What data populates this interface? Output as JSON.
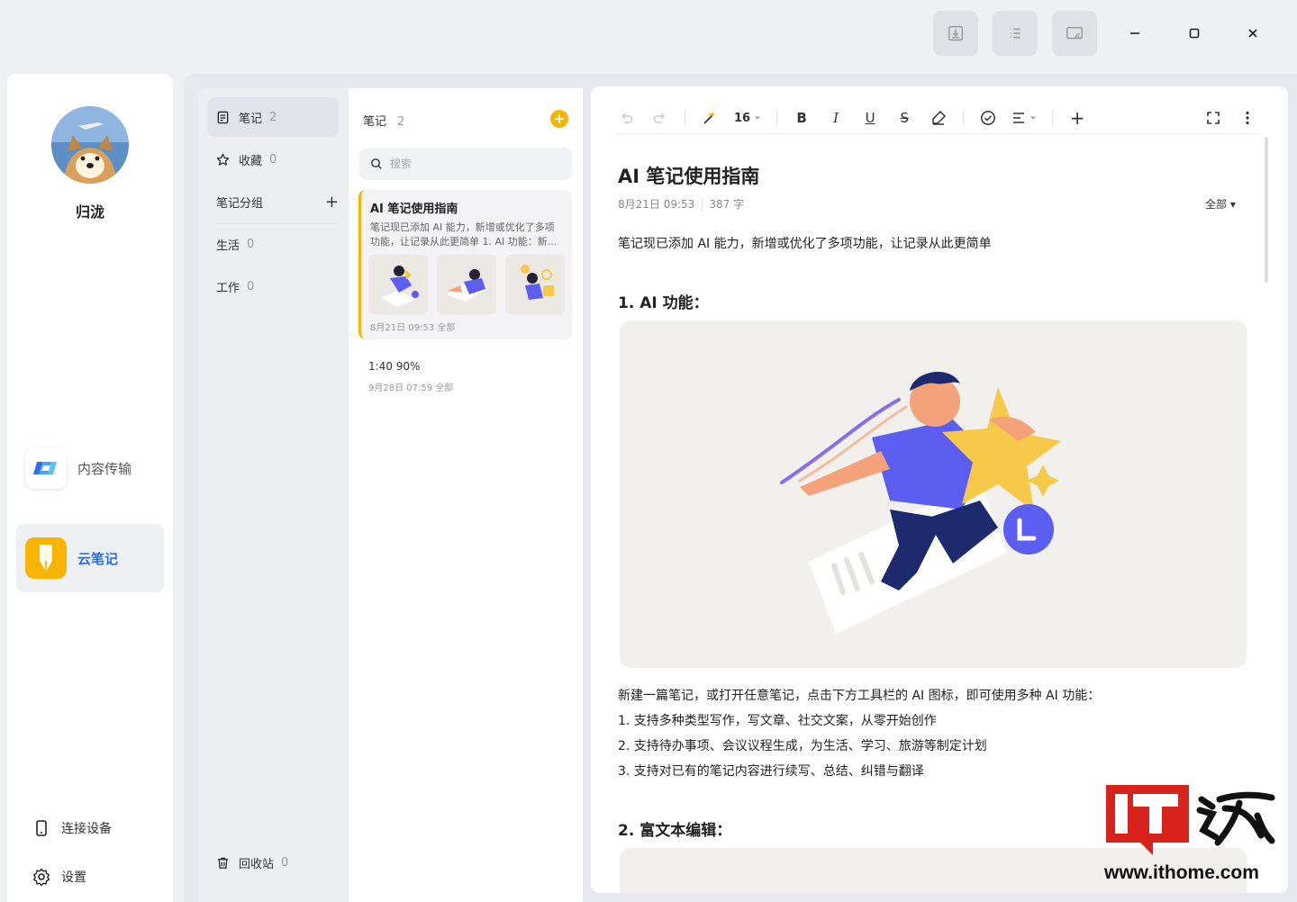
{
  "titlebar": {
    "buttons": [
      {
        "icon": "import-icon"
      },
      {
        "icon": "list-icon"
      },
      {
        "icon": "cast-icon"
      }
    ],
    "window_controls": [
      "minimize-icon",
      "maximize-icon",
      "close-icon"
    ]
  },
  "sidebar": {
    "username": "归泷",
    "apps": [
      {
        "label": "内容传输",
        "icon": "transfer-icon",
        "active": false
      },
      {
        "label": "云笔记",
        "icon": "cloud-notes-icon",
        "active": true
      }
    ],
    "bottom": [
      {
        "label": "连接设备",
        "icon": "phone-icon"
      },
      {
        "label": "设置",
        "icon": "gear-icon"
      }
    ]
  },
  "categories": {
    "notes": {
      "label": "笔记",
      "count": "2"
    },
    "favorites": {
      "label": "收藏",
      "count": "0"
    },
    "group_header": "笔记分组",
    "groups": [
      {
        "label": "生活",
        "count": "0"
      },
      {
        "label": "工作",
        "count": "0"
      }
    ],
    "trash": {
      "label": "回收站",
      "count": "0"
    }
  },
  "notes_list": {
    "title": "笔记",
    "count": "2",
    "search_placeholder": "搜索",
    "items": [
      {
        "title": "AI 笔记使用指南",
        "snippet": "笔记现已添加 AI 能力，新增或优化了多项功能，让记录从此更简单 1. AI 功能：新...",
        "meta": "8月21日 09:53  全部"
      },
      {
        "title": "1:40 90%",
        "meta": "9月28日 07:59  全部"
      }
    ]
  },
  "editor": {
    "toolbar": {
      "font_size": "16",
      "bold": "B",
      "italic": "I",
      "underline": "U",
      "strike": "S",
      "add": "+"
    },
    "title": "AI 笔记使用指南",
    "date": "8月21日 09:53",
    "word_count": "387 字",
    "filter": "全部 ▾",
    "intro": "笔记现已添加 AI 能力，新增或优化了多项功能，让记录从此更简单",
    "section1": "1. AI 功能：",
    "paragraph1": "新建一篇笔记，或打开任意笔记，点击下方工具栏的 AI 图标，即可使用多种 AI 功能：",
    "list": [
      "1. 支持多种类型写作，写文章、社交文案，从零开始创作",
      "2. 支持待办事项、会议议程生成，为生活、学习、旅游等制定计划",
      "3. 支持对已有的笔记内容进行续写、总结、纠错与翻译"
    ],
    "section2": "2. 富文本编辑："
  },
  "watermark": {
    "url": "www.ithome.com"
  },
  "colors": {
    "accent_blue": "#2a6fe8",
    "accent_yellow": "#f7b500",
    "watermark_red": "#d7231c"
  }
}
